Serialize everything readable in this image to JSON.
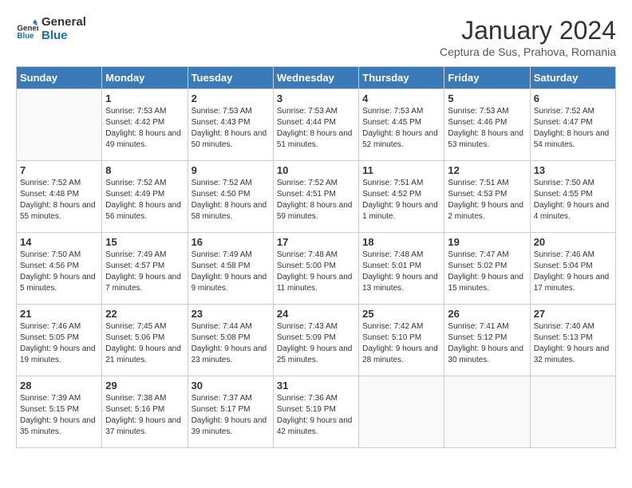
{
  "header": {
    "logo": "GeneralBlue",
    "month": "January 2024",
    "location": "Ceptura de Sus, Prahova, Romania"
  },
  "days_of_week": [
    "Sunday",
    "Monday",
    "Tuesday",
    "Wednesday",
    "Thursday",
    "Friday",
    "Saturday"
  ],
  "weeks": [
    [
      {
        "num": "",
        "empty": true
      },
      {
        "num": "1",
        "sunrise": "7:53 AM",
        "sunset": "4:42 PM",
        "daylight": "8 hours and 49 minutes."
      },
      {
        "num": "2",
        "sunrise": "7:53 AM",
        "sunset": "4:43 PM",
        "daylight": "8 hours and 50 minutes."
      },
      {
        "num": "3",
        "sunrise": "7:53 AM",
        "sunset": "4:44 PM",
        "daylight": "8 hours and 51 minutes."
      },
      {
        "num": "4",
        "sunrise": "7:53 AM",
        "sunset": "4:45 PM",
        "daylight": "8 hours and 52 minutes."
      },
      {
        "num": "5",
        "sunrise": "7:53 AM",
        "sunset": "4:46 PM",
        "daylight": "8 hours and 53 minutes."
      },
      {
        "num": "6",
        "sunrise": "7:52 AM",
        "sunset": "4:47 PM",
        "daylight": "8 hours and 54 minutes."
      }
    ],
    [
      {
        "num": "7",
        "sunrise": "7:52 AM",
        "sunset": "4:48 PM",
        "daylight": "8 hours and 55 minutes."
      },
      {
        "num": "8",
        "sunrise": "7:52 AM",
        "sunset": "4:49 PM",
        "daylight": "8 hours and 56 minutes."
      },
      {
        "num": "9",
        "sunrise": "7:52 AM",
        "sunset": "4:50 PM",
        "daylight": "8 hours and 58 minutes."
      },
      {
        "num": "10",
        "sunrise": "7:52 AM",
        "sunset": "4:51 PM",
        "daylight": "8 hours and 59 minutes."
      },
      {
        "num": "11",
        "sunrise": "7:51 AM",
        "sunset": "4:52 PM",
        "daylight": "9 hours and 1 minute."
      },
      {
        "num": "12",
        "sunrise": "7:51 AM",
        "sunset": "4:53 PM",
        "daylight": "9 hours and 2 minutes."
      },
      {
        "num": "13",
        "sunrise": "7:50 AM",
        "sunset": "4:55 PM",
        "daylight": "9 hours and 4 minutes."
      }
    ],
    [
      {
        "num": "14",
        "sunrise": "7:50 AM",
        "sunset": "4:56 PM",
        "daylight": "9 hours and 5 minutes."
      },
      {
        "num": "15",
        "sunrise": "7:49 AM",
        "sunset": "4:57 PM",
        "daylight": "9 hours and 7 minutes."
      },
      {
        "num": "16",
        "sunrise": "7:49 AM",
        "sunset": "4:58 PM",
        "daylight": "9 hours and 9 minutes."
      },
      {
        "num": "17",
        "sunrise": "7:48 AM",
        "sunset": "5:00 PM",
        "daylight": "9 hours and 11 minutes."
      },
      {
        "num": "18",
        "sunrise": "7:48 AM",
        "sunset": "5:01 PM",
        "daylight": "9 hours and 13 minutes."
      },
      {
        "num": "19",
        "sunrise": "7:47 AM",
        "sunset": "5:02 PM",
        "daylight": "9 hours and 15 minutes."
      },
      {
        "num": "20",
        "sunrise": "7:46 AM",
        "sunset": "5:04 PM",
        "daylight": "9 hours and 17 minutes."
      }
    ],
    [
      {
        "num": "21",
        "sunrise": "7:46 AM",
        "sunset": "5:05 PM",
        "daylight": "9 hours and 19 minutes."
      },
      {
        "num": "22",
        "sunrise": "7:45 AM",
        "sunset": "5:06 PM",
        "daylight": "9 hours and 21 minutes."
      },
      {
        "num": "23",
        "sunrise": "7:44 AM",
        "sunset": "5:08 PM",
        "daylight": "9 hours and 23 minutes."
      },
      {
        "num": "24",
        "sunrise": "7:43 AM",
        "sunset": "5:09 PM",
        "daylight": "9 hours and 25 minutes."
      },
      {
        "num": "25",
        "sunrise": "7:42 AM",
        "sunset": "5:10 PM",
        "daylight": "9 hours and 28 minutes."
      },
      {
        "num": "26",
        "sunrise": "7:41 AM",
        "sunset": "5:12 PM",
        "daylight": "9 hours and 30 minutes."
      },
      {
        "num": "27",
        "sunrise": "7:40 AM",
        "sunset": "5:13 PM",
        "daylight": "9 hours and 32 minutes."
      }
    ],
    [
      {
        "num": "28",
        "sunrise": "7:39 AM",
        "sunset": "5:15 PM",
        "daylight": "9 hours and 35 minutes."
      },
      {
        "num": "29",
        "sunrise": "7:38 AM",
        "sunset": "5:16 PM",
        "daylight": "9 hours and 37 minutes."
      },
      {
        "num": "30",
        "sunrise": "7:37 AM",
        "sunset": "5:17 PM",
        "daylight": "9 hours and 39 minutes."
      },
      {
        "num": "31",
        "sunrise": "7:36 AM",
        "sunset": "5:19 PM",
        "daylight": "9 hours and 42 minutes."
      },
      {
        "num": "",
        "empty": true
      },
      {
        "num": "",
        "empty": true
      },
      {
        "num": "",
        "empty": true
      }
    ]
  ]
}
